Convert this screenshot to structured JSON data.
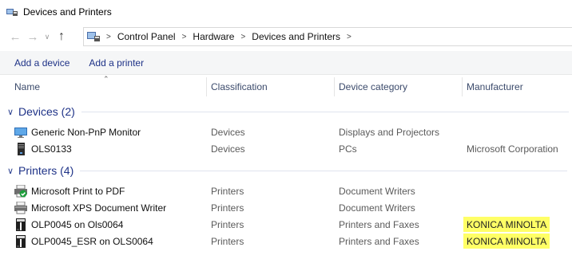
{
  "window": {
    "title": "Devices and Printers"
  },
  "nav": {
    "back_icon": "arrow-left-icon",
    "forward_icon": "arrow-right-icon",
    "recent_icon": "chevron-down-icon",
    "up_icon": "arrow-up-icon"
  },
  "breadcrumb": [
    "Control Panel",
    "Hardware",
    "Devices and Printers"
  ],
  "commands": [
    "Add a device",
    "Add a printer"
  ],
  "columns": [
    "Name",
    "Classification",
    "Device category",
    "Manufacturer"
  ],
  "groups": [
    {
      "title": "Devices (2)",
      "items": [
        {
          "name": "Generic Non-PnP Monitor",
          "classification": "Devices",
          "category": "Displays and Projectors",
          "manufacturer": "",
          "icon": "monitor-icon"
        },
        {
          "name": "OLS0133",
          "classification": "Devices",
          "category": "PCs",
          "manufacturer": "Microsoft Corporation",
          "icon": "pc-tower-icon"
        }
      ]
    },
    {
      "title": "Printers (4)",
      "items": [
        {
          "name": "Microsoft Print to PDF",
          "classification": "Printers",
          "category": "Document Writers",
          "manufacturer": "",
          "icon": "default-printer-icon"
        },
        {
          "name": "Microsoft XPS Document Writer",
          "classification": "Printers",
          "category": "Document Writers",
          "manufacturer": "",
          "icon": "printer-icon"
        },
        {
          "name": "OLP0045 on Ols0064",
          "classification": "Printers",
          "category": "Printers and Faxes",
          "manufacturer": "KONICA MINOLTA",
          "icon": "network-printer-icon",
          "highlight": true
        },
        {
          "name": "OLP0045_ESR on OLS0064",
          "classification": "Printers",
          "category": "Printers and Faxes",
          "manufacturer": "KONICA MINOLTA",
          "icon": "network-printer-icon",
          "highlight": true
        }
      ]
    }
  ],
  "colors": {
    "link": "#1e3287",
    "highlight": "#ffff66",
    "commandbar": "#f5f6f7"
  }
}
